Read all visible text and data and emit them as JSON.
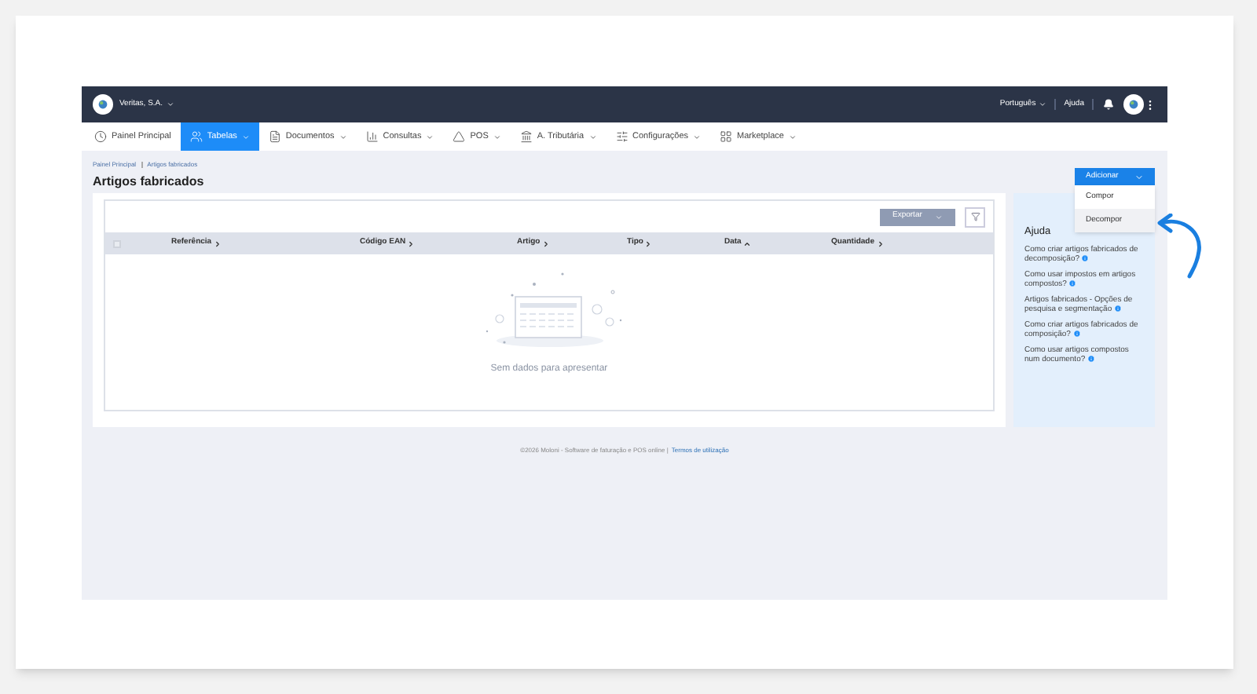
{
  "topbar": {
    "company": "Veritas, S.A.",
    "language": "Português",
    "help": "Ajuda"
  },
  "nav": [
    {
      "label": "Painel Principal",
      "selected": false,
      "menu": false
    },
    {
      "label": "Tabelas",
      "selected": true,
      "menu": true
    },
    {
      "label": "Documentos",
      "selected": false,
      "menu": true
    },
    {
      "label": "Consultas",
      "selected": false,
      "menu": true
    },
    {
      "label": "POS",
      "selected": false,
      "menu": true
    },
    {
      "label": "A. Tributária",
      "selected": false,
      "menu": true
    },
    {
      "label": "Configurações",
      "selected": false,
      "menu": true
    },
    {
      "label": "Marketplace",
      "selected": false,
      "menu": true
    }
  ],
  "breadcrumb": [
    "Painel Principal",
    "Artigos fabricados"
  ],
  "title": "Artigos fabricados",
  "add_button": {
    "label": "Adicionar",
    "expanded": true,
    "items": [
      {
        "label": "Compor",
        "selected": false
      },
      {
        "label": "Decompor",
        "selected": true
      }
    ]
  },
  "table": {
    "export": "Exportar",
    "select_all": {
      "checked": false
    },
    "columns": [
      {
        "label": "Referência",
        "sorted": false
      },
      {
        "label": "Código EAN",
        "sorted": false
      },
      {
        "label": "Artigo",
        "sorted": false
      },
      {
        "label": "Tipo",
        "sorted": false
      },
      {
        "label": "Data",
        "sorted": true
      },
      {
        "label": "Quantidade",
        "sorted": false
      }
    ],
    "empty": "Sem dados para apresentar"
  },
  "help_panel": {
    "title": "Ajuda",
    "links": [
      "Como criar artigos fabricados de decomposição?",
      "Como usar impostos em artigos compostos?",
      "Artigos fabricados - Opções de pesquisa e segmentação",
      "Como criar artigos fabricados de composição?",
      "Como usar artigos compostos num documento?"
    ]
  },
  "footer": {
    "text": "©2026 Moloni - Software de faturação e POS online |",
    "link": "Termos de utilização"
  }
}
